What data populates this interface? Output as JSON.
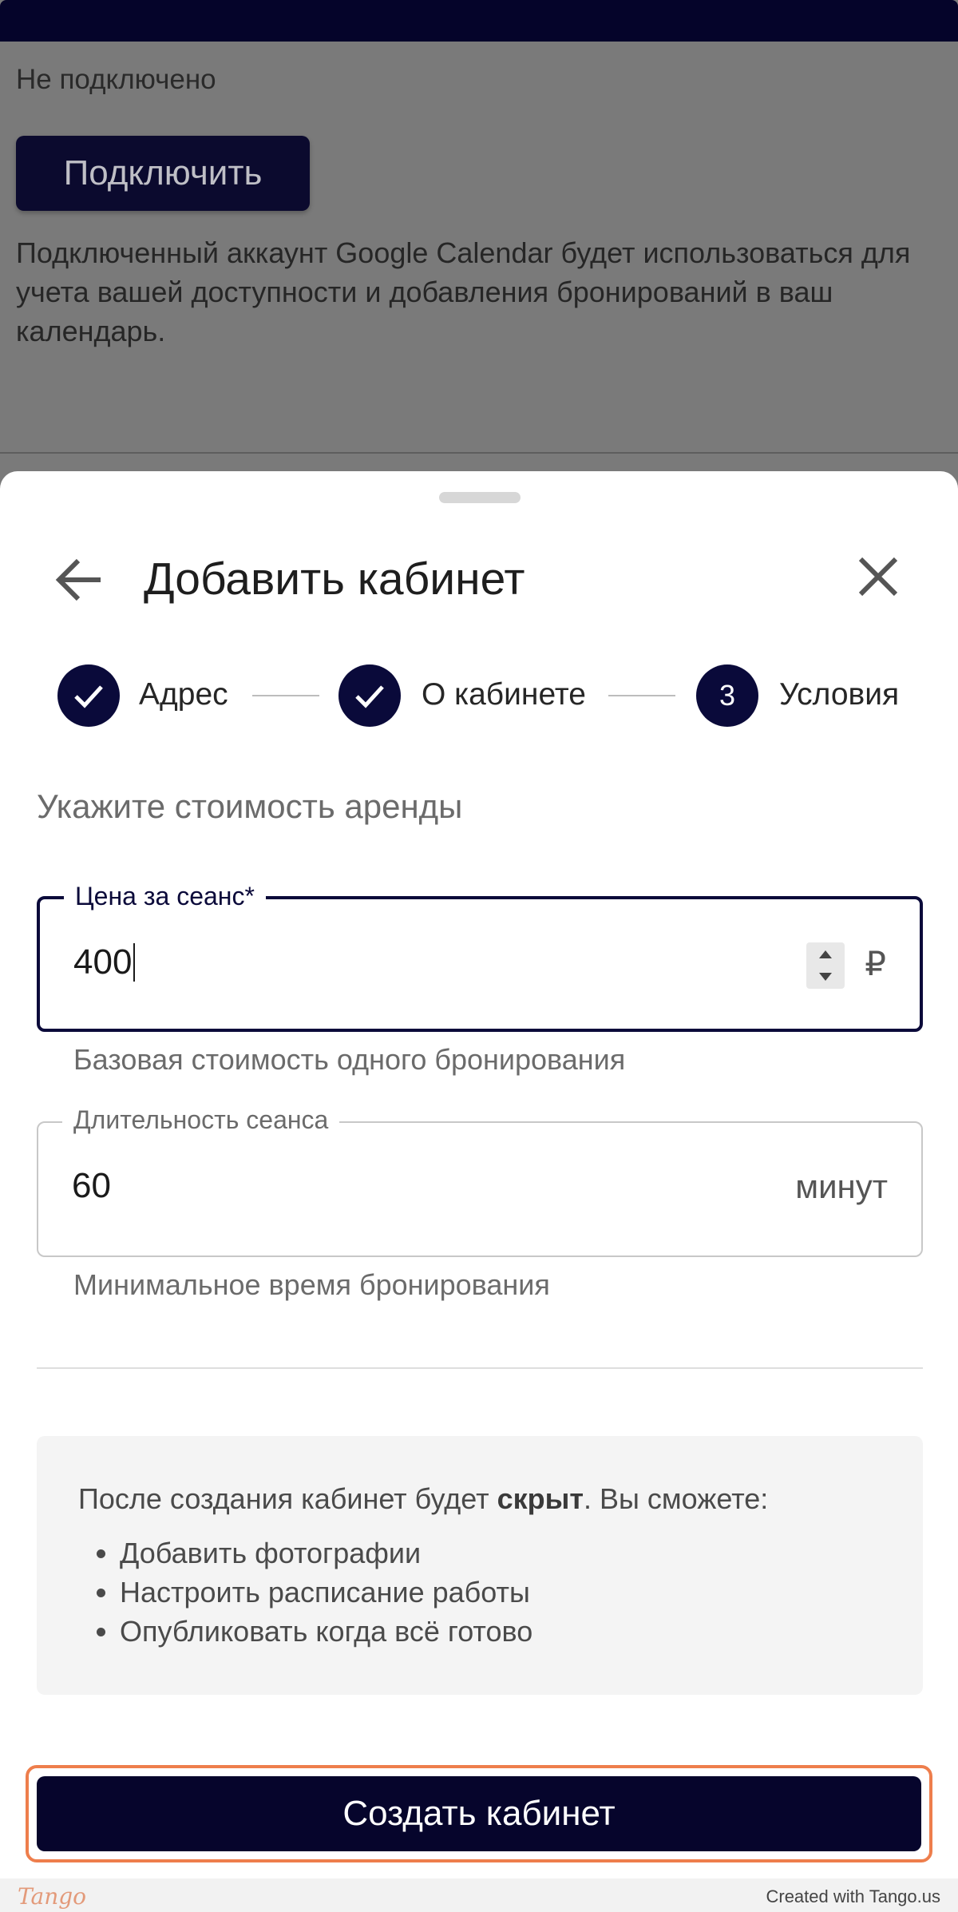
{
  "background": {
    "connection_status": "Не подключено",
    "connect_button": "Подключить",
    "description": "Подключенный аккаунт Google Calendar будет использоваться для учета вашей доступности и добавления бронирований в ваш календарь."
  },
  "sheet": {
    "title": "Добавить кабинет",
    "back_icon": "arrow-left-icon",
    "close_icon": "close-icon",
    "steps": [
      {
        "label": "Адрес",
        "state": "done",
        "icon": "check-icon"
      },
      {
        "label": "О кабинете",
        "state": "done",
        "icon": "check-icon"
      },
      {
        "label": "Условия",
        "state": "current",
        "number": "3"
      }
    ],
    "section_title": "Укажите стоимость аренды",
    "price_field": {
      "label": "Цена за сеанс*",
      "value": "400",
      "unit": "₽",
      "helper": "Базовая стоимость одного бронирования"
    },
    "duration_field": {
      "label": "Длительность сеанса",
      "value": "60",
      "unit": "минут",
      "helper": "Минимальное время бронирования"
    },
    "info": {
      "text_before": "После создания кабинет будет ",
      "text_bold": "скрыт",
      "text_after": ". Вы сможете:",
      "items": [
        "Добавить фотографии",
        "Настроить расписание работы",
        "Опубликовать когда всё готово"
      ]
    },
    "create_button": "Создать кабинет"
  },
  "footer": {
    "logo": "Tango",
    "credit": "Created with Tango.us"
  },
  "colors": {
    "primary": "#06052c",
    "highlight": "#ee7e4c",
    "overlay": "#7a7a7a",
    "info_bg": "#f4f4f4"
  }
}
